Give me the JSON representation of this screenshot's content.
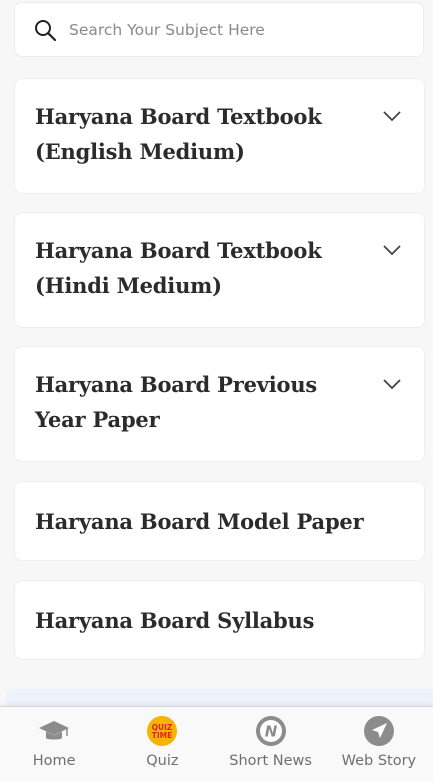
{
  "search": {
    "placeholder": "Search Your Subject Here",
    "icon": "search-icon"
  },
  "cards": [
    {
      "title": "Haryana Board Textbook (English Medium)",
      "expandable": true
    },
    {
      "title": "Haryana Board Textbook (Hindi Medium)",
      "expandable": true
    },
    {
      "title": "Haryana Board Previous Year Paper",
      "expandable": true
    },
    {
      "title": "Haryana Board Model Paper",
      "expandable": false
    },
    {
      "title": "Haryana Board Syllabus",
      "expandable": false
    }
  ],
  "bottom_nav": {
    "items": [
      {
        "label": "Home",
        "icon": "graduation-cap-icon"
      },
      {
        "label": "Quiz",
        "icon": "quiz-time-icon",
        "badge_line1": "QUIZ",
        "badge_line2": "TIME"
      },
      {
        "label": "Short News",
        "icon": "news-n-icon",
        "glyph": "N"
      },
      {
        "label": "Web Story",
        "icon": "paper-plane-icon"
      }
    ]
  },
  "colors": {
    "card_title": "#2b2b2b",
    "nav_label": "#6f6f6f",
    "quiz_badge": "#f5b400",
    "quiz_text": "#d9262c",
    "icon_gray": "#8c8c8c"
  }
}
